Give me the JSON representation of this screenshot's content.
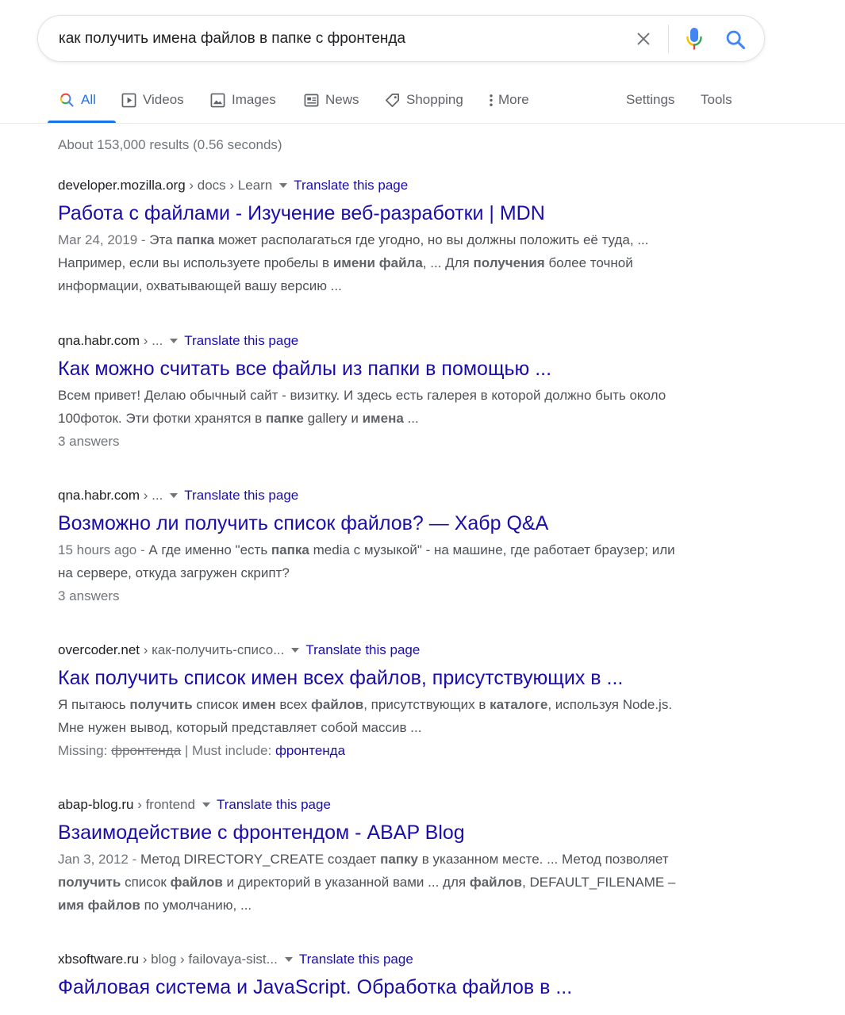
{
  "search": {
    "query": "как получить имена файлов в папке с фронтенда"
  },
  "icons": {
    "clear": "close-icon",
    "mic": "microphone-icon",
    "search": "search-icon"
  },
  "colors": {
    "link": "#1a0dab",
    "accent": "#1a73e8",
    "mic_blue": "#4285f4",
    "mic_red": "#ea4335",
    "mic_yellow": "#fbbc04",
    "mic_green": "#34a853"
  },
  "tabs": {
    "all": "All",
    "videos": "Videos",
    "images": "Images",
    "news": "News",
    "shopping": "Shopping",
    "more": "More",
    "settings": "Settings",
    "tools": "Tools"
  },
  "stats": "About 153,000 results (0.56 seconds)",
  "translate_label": "Translate this page",
  "results": [
    {
      "domain": "developer.mozilla.org",
      "path": " › docs › Learn",
      "title": "Работа с файлами - Изучение веб-разработки | MDN",
      "date": "Mar 24, 2019 - ",
      "s1": "Эта ",
      "b1": "папка",
      "s2": " может располагаться где угодно, но вы должны положить её туда, ... Например, если вы используете пробелы в ",
      "b2": "имени файла",
      "s3": ", ... Для ",
      "b3": "получения",
      "s4": " более точной информации, охватывающей вашу версию ..."
    },
    {
      "domain": "qna.habr.com",
      "path": " › ...",
      "title": "Как можно считать все файлы из папки в помощью ...",
      "s1": "Всем привет! Делаю обычный сайт - визитку. И здесь есть галерея в которой должно быть около 100фоток. Эти фотки хранятся в ",
      "b1": "папке",
      "s2": " gallery и ",
      "b2": "имена",
      "s3": " ...",
      "answers": "3 answers"
    },
    {
      "domain": "qna.habr.com",
      "path": " › ...",
      "title": "Возможно ли получить список файлов? — Хабр Q&A",
      "date": "15 hours ago - ",
      "s1": "А где именно \"есть ",
      "b1": "папка",
      "s2": " media с музыкой\" - на машине, где работает браузер; или на сервере, откуда загружен скрипт?",
      "answers": "3 answers"
    },
    {
      "domain": "overcoder.net",
      "path": " › как-получить-списо...",
      "title": "Как получить список имен всех файлов, присутствующих в ...",
      "s1": "Я пытаюсь ",
      "b1": "получить",
      "s2": " список ",
      "b2": "имен",
      "s3": " всех ",
      "b3": "файлов",
      "s4": ", присутствующих в ",
      "b4": "каталоге",
      "s5": ", используя Node.js. Мне нужен вывод, который представляет собой массив ...",
      "missing_label": "Missing: ",
      "missing_term": "фронтенда",
      "must_label": " | Must include: ",
      "must_term": "фронтенда"
    },
    {
      "domain": "abap-blog.ru",
      "path": " › frontend",
      "title": "Взаимодействие с фронтендом - ABAP Blog",
      "date": "Jan 3, 2012 - ",
      "s1": "Метод DIRECTORY_CREATE создает ",
      "b1": "папку",
      "s2": " в указанном месте. ... Метод позволяет ",
      "b2": "получить",
      "s3": " список ",
      "b3": "файлов",
      "s4": " и директорий в указанной вами ... для ",
      "b4": "файлов",
      "s5": ", DEFAULT_FILENAME – ",
      "b5": "имя файлов",
      "s6": " по умолчанию, ..."
    },
    {
      "domain": "xbsoftware.ru",
      "path": " › blog › failovaya-sist...",
      "title": "Файловая система и JavaScript. Обработка файлов в ..."
    }
  ]
}
